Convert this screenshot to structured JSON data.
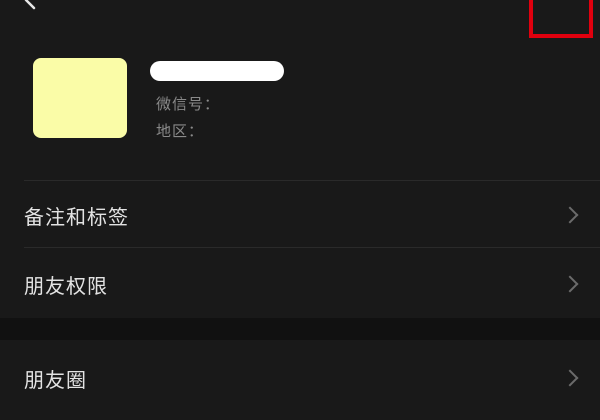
{
  "header": {
    "back_icon": "chevron-left-icon",
    "more_icon": "more-options-icon",
    "highlight_color": "#e0000e"
  },
  "profile": {
    "avatar_color": "#fafca7",
    "name": "",
    "wechat_id_label": "微信号：",
    "region_label": "地区："
  },
  "menu": {
    "remarks_tags": "备注和标签",
    "friend_permissions": "朋友权限",
    "moments": "朋友圈"
  }
}
